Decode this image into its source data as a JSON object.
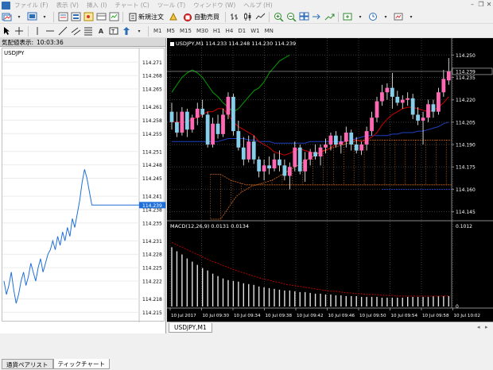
{
  "menu": [
    "ファイル (F)",
    "表示 (V)",
    "挿入 (I)",
    "チャート (C)",
    "ツール (T)",
    "ウィンドウ (W)",
    "ヘルプ (H)"
  ],
  "toolbar": {
    "new_order": "新規注文",
    "auto_trade": "自動売買",
    "timeframes": [
      "M1",
      "M5",
      "M15",
      "M30",
      "H1",
      "H4",
      "D1",
      "W1",
      "MN"
    ]
  },
  "market_watch": {
    "title": "気配値表示:",
    "time": "10:03:36",
    "symbol": "USDJPY",
    "price_labels": [
      "114.271",
      "114.268",
      "114.265",
      "114.261",
      "114.258",
      "114.255",
      "114.251",
      "114.248",
      "114.245",
      "114.241",
      "114.238",
      "114.235",
      "114.231",
      "114.228",
      "114.225",
      "114.222",
      "114.218",
      "114.215"
    ],
    "current_price": "114.239",
    "tabs": [
      "通貨ペアリスト",
      "ティックチャート"
    ]
  },
  "chart": {
    "header": "USDJPY,M1  114.233 114.248 114.230 114.239",
    "price_labels": [
      "114.250",
      "114.235",
      "114.220",
      "114.205",
      "114.190",
      "114.175",
      "114.160",
      "114.145"
    ],
    "current_price": "114.239",
    "macd_header": "MACD(12,26,9) 0.0131 0.0134",
    "macd_labels": [
      "0.1012",
      "0"
    ],
    "time_labels": [
      "10 Jul 2017",
      "10 Jul 09:30",
      "10 Jul 09:34",
      "10 Jul 09:38",
      "10 Jul 09:42",
      "10 Jul 09:46",
      "10 Jul 09:50",
      "10 Jul 09:54",
      "10 Jul 09:58",
      "10 Jul 10:02"
    ],
    "tab": "USDJPY,M1"
  },
  "colors": {
    "bull": "#ff69b4",
    "bear": "#87ceeb",
    "tick_line": "#1e6fd9",
    "tenkan": "#cc0000",
    "kijun": "#1f3fbf",
    "chikou": "#00a000",
    "cloud": "#d2691e"
  },
  "chart_data": [
    {
      "type": "line",
      "series": [
        {
          "values": [
            114.222,
            114.219,
            114.221,
            114.224,
            114.22,
            114.217,
            114.219,
            114.222,
            114.224,
            114.221,
            114.223,
            114.226,
            114.224,
            114.222,
            114.225,
            114.227,
            114.224,
            114.226,
            114.228,
            114.229,
            114.231,
            114.229,
            114.232,
            114.23,
            114.233,
            114.231,
            114.234,
            114.232,
            114.236,
            114.234,
            114.237,
            114.24,
            114.244,
            114.247,
            114.245,
            114.242,
            114.239,
            114.239,
            114.239,
            114.239,
            114.239,
            114.239,
            114.239,
            114.239
          ]
        }
      ],
      "ylim": [
        114.214,
        114.273
      ]
    },
    {
      "type": "candlestick",
      "ylim": [
        114.14,
        114.256
      ],
      "candles": [
        [
          114.212,
          114.218,
          114.2,
          114.205
        ],
        [
          114.205,
          114.212,
          114.195,
          114.198
        ],
        [
          114.198,
          114.215,
          114.196,
          114.212
        ],
        [
          114.212,
          114.214,
          114.195,
          114.2
        ],
        [
          114.2,
          114.21,
          114.198,
          114.208
        ],
        [
          114.208,
          114.218,
          114.203,
          114.214
        ],
        [
          114.214,
          114.22,
          114.208,
          114.21
        ],
        [
          114.21,
          114.212,
          114.188,
          114.19
        ],
        [
          114.19,
          114.208,
          114.188,
          114.204
        ],
        [
          114.204,
          114.21,
          114.194,
          114.197
        ],
        [
          114.197,
          114.214,
          114.195,
          114.21
        ],
        [
          114.21,
          114.225,
          114.207,
          114.222
        ],
        [
          114.222,
          114.224,
          114.196,
          114.199
        ],
        [
          114.199,
          114.206,
          114.186,
          114.188
        ],
        [
          114.188,
          114.195,
          114.176,
          114.18
        ],
        [
          114.18,
          114.196,
          114.178,
          114.192
        ],
        [
          114.192,
          114.196,
          114.177,
          114.18
        ],
        [
          114.18,
          114.182,
          114.168,
          114.172
        ],
        [
          114.172,
          114.18,
          114.166,
          114.176
        ],
        [
          114.176,
          114.182,
          114.17,
          114.174
        ],
        [
          114.174,
          114.184,
          114.172,
          114.18
        ],
        [
          114.18,
          114.186,
          114.172,
          114.176
        ],
        [
          114.176,
          114.18,
          114.166,
          114.169
        ],
        [
          114.169,
          114.178,
          114.16,
          114.175
        ],
        [
          114.175,
          114.192,
          114.172,
          114.188
        ],
        [
          114.188,
          114.19,
          114.17,
          114.172
        ],
        [
          114.172,
          114.185,
          114.165,
          114.18
        ],
        [
          114.18,
          114.187,
          114.176,
          114.185
        ],
        [
          114.185,
          114.19,
          114.18,
          114.182
        ],
        [
          114.182,
          114.19,
          114.176,
          114.188
        ],
        [
          114.188,
          114.194,
          114.184,
          114.19
        ],
        [
          114.19,
          114.198,
          114.186,
          114.196
        ],
        [
          114.196,
          114.199,
          114.188,
          114.19
        ],
        [
          114.19,
          114.196,
          114.184,
          114.192
        ],
        [
          114.192,
          114.202,
          114.188,
          114.198
        ],
        [
          114.198,
          114.2,
          114.186,
          114.19
        ],
        [
          114.19,
          114.195,
          114.184,
          114.186
        ],
        [
          114.186,
          114.192,
          114.183,
          114.19
        ],
        [
          114.19,
          114.202,
          114.186,
          114.199
        ],
        [
          114.199,
          114.212,
          114.196,
          114.208
        ],
        [
          114.208,
          114.222,
          114.205,
          114.219
        ],
        [
          114.219,
          114.23,
          114.216,
          114.225
        ],
        [
          114.225,
          114.231,
          114.22,
          114.228
        ],
        [
          114.228,
          114.238,
          114.214,
          114.222
        ],
        [
          114.222,
          114.226,
          114.216,
          114.218
        ],
        [
          114.218,
          114.223,
          114.214,
          114.22
        ],
        [
          114.22,
          114.225,
          114.216,
          114.221
        ],
        [
          114.221,
          114.224,
          114.207,
          114.21
        ],
        [
          114.21,
          114.215,
          114.203,
          114.206
        ],
        [
          114.206,
          114.212,
          114.19,
          114.208
        ],
        [
          114.208,
          114.22,
          114.205,
          114.217
        ],
        [
          114.217,
          114.22,
          114.208,
          114.212
        ],
        [
          114.212,
          114.228,
          114.21,
          114.225
        ],
        [
          114.225,
          114.24,
          114.222,
          114.234
        ],
        [
          114.233,
          114.248,
          114.23,
          114.239
        ]
      ],
      "indicators": {
        "tenkan": [
          114.205,
          114.205,
          114.205,
          114.205,
          114.207,
          114.208,
          114.21,
          114.212,
          114.212,
          114.214,
          114.214,
          114.21,
          114.205,
          114.202,
          114.2,
          114.198,
          114.196,
          114.192,
          114.19,
          114.188,
          114.185,
          114.184,
          114.183,
          114.184,
          114.186,
          114.187,
          114.186,
          114.185,
          114.184,
          114.185,
          114.186,
          114.188,
          114.19,
          114.191,
          114.192,
          114.193,
          114.193,
          114.192,
          114.193,
          114.195,
          114.198,
          114.203,
          114.207,
          114.21,
          114.212,
          114.214,
          114.215,
          114.215,
          114.214,
          114.213,
          114.212,
          114.213,
          114.215,
          114.218,
          114.222
        ],
        "kijun": [
          114.192,
          114.192,
          114.192,
          114.192,
          114.192,
          114.192,
          114.192,
          114.192,
          114.192,
          114.192,
          114.193,
          114.194,
          114.194,
          114.194,
          114.194,
          114.193,
          114.193,
          114.192,
          114.192,
          114.192,
          114.191,
          114.191,
          114.191,
          114.191,
          114.191,
          114.191,
          114.191,
          114.192,
          114.192,
          114.192,
          114.192,
          114.192,
          114.192,
          114.192,
          114.192,
          114.193,
          114.194,
          114.195,
          114.196,
          114.196,
          114.196,
          114.196,
          114.196,
          114.197,
          114.197,
          114.198,
          114.198,
          114.198,
          114.199,
          114.199,
          114.2,
          114.201,
          114.202,
          114.204,
          114.205
        ],
        "chikou": [
          114.225,
          114.23,
          114.235,
          114.238,
          114.24,
          114.238,
          114.235,
          114.23,
          114.225,
          114.222,
          114.218,
          114.215,
          114.212,
          114.214,
          114.218,
          114.222,
          114.226,
          114.228,
          114.232,
          114.238,
          114.242,
          114.246,
          114.248,
          114.25
        ],
        "cloud_upper": [
          114.17,
          114.17,
          114.17,
          114.168,
          114.166,
          114.165,
          114.164,
          114.163,
          114.163,
          114.163,
          114.164,
          114.165,
          114.166,
          114.168,
          114.17,
          114.172,
          114.174,
          114.176,
          114.178,
          114.18,
          114.182,
          114.184,
          114.186,
          114.187,
          114.188,
          114.189,
          114.19,
          114.191,
          114.192,
          114.193,
          114.193,
          114.193,
          114.193,
          114.193,
          114.193,
          114.193,
          114.193,
          114.193,
          114.193,
          114.193,
          114.193,
          114.193,
          114.193,
          114.193,
          114.193,
          114.193,
          114.193,
          114.193,
          114.193,
          114.193,
          114.193,
          114.192,
          114.192,
          114.192,
          114.192,
          114.192,
          114.192,
          114.192,
          114.192,
          114.192,
          114.192,
          114.192,
          114.192,
          114.192,
          114.192,
          114.192,
          114.192,
          114.192,
          114.192,
          114.192,
          114.192,
          114.192,
          114.192,
          114.192,
          114.192,
          114.192,
          114.192,
          114.192,
          114.192,
          114.192,
          114.191
        ],
        "cloud_lower": [
          114.14,
          114.14,
          114.14,
          114.145,
          114.15,
          114.155,
          114.158,
          114.16,
          114.162,
          114.163,
          114.163,
          114.163,
          114.163,
          114.163,
          114.163,
          114.163,
          114.163,
          114.163,
          114.163,
          114.163,
          114.163,
          114.163,
          114.163,
          114.163,
          114.163,
          114.163,
          114.163,
          114.163,
          114.163,
          114.163,
          114.163,
          114.163,
          114.163,
          114.163,
          114.163,
          114.163,
          114.163,
          114.163,
          114.163,
          114.163,
          114.163,
          114.163,
          114.163,
          114.163,
          114.163,
          114.163,
          114.163,
          114.163,
          114.163,
          114.163,
          114.163,
          114.163,
          114.163,
          114.163,
          114.163,
          114.163,
          114.163,
          114.163,
          114.163,
          114.163,
          114.163,
          114.163,
          114.163,
          114.163,
          114.163,
          114.163,
          114.163,
          114.163,
          114.163,
          114.163,
          114.163,
          114.163,
          114.163,
          114.163,
          114.163,
          114.163,
          114.163,
          114.163,
          114.163,
          114.163,
          114.163
        ]
      }
    },
    {
      "type": "bar",
      "ylim": [
        0,
        0.1012
      ],
      "macd_values": [
        0.074,
        0.069,
        0.065,
        0.06,
        0.056,
        0.052,
        0.048,
        0.045,
        0.041,
        0.038,
        0.035,
        0.033,
        0.032,
        0.031,
        0.029,
        0.028,
        0.027,
        0.025,
        0.024,
        0.023,
        0.022,
        0.021,
        0.02,
        0.02,
        0.019,
        0.018,
        0.018,
        0.017,
        0.016,
        0.016,
        0.015,
        0.015,
        0.014,
        0.014,
        0.013,
        0.013,
        0.013,
        0.012,
        0.012,
        0.012,
        0.012,
        0.011,
        0.011,
        0.011,
        0.011,
        0.011,
        0.012,
        0.012,
        0.012,
        0.012,
        0.012,
        0.013,
        0.013,
        0.013,
        0.013
      ],
      "signal_values": [
        0.08,
        0.077,
        0.074,
        0.071,
        0.068,
        0.065,
        0.062,
        0.059,
        0.056,
        0.054,
        0.051,
        0.049,
        0.046,
        0.044,
        0.042,
        0.04,
        0.038,
        0.036,
        0.034,
        0.033,
        0.031,
        0.03,
        0.028,
        0.027,
        0.026,
        0.025,
        0.024,
        0.023,
        0.022,
        0.021,
        0.02,
        0.019,
        0.019,
        0.018,
        0.017,
        0.017,
        0.016,
        0.016,
        0.015,
        0.015,
        0.015,
        0.014,
        0.014,
        0.014,
        0.013,
        0.013,
        0.013,
        0.013,
        0.013,
        0.013,
        0.013,
        0.013,
        0.013,
        0.013,
        0.0134
      ]
    }
  ]
}
